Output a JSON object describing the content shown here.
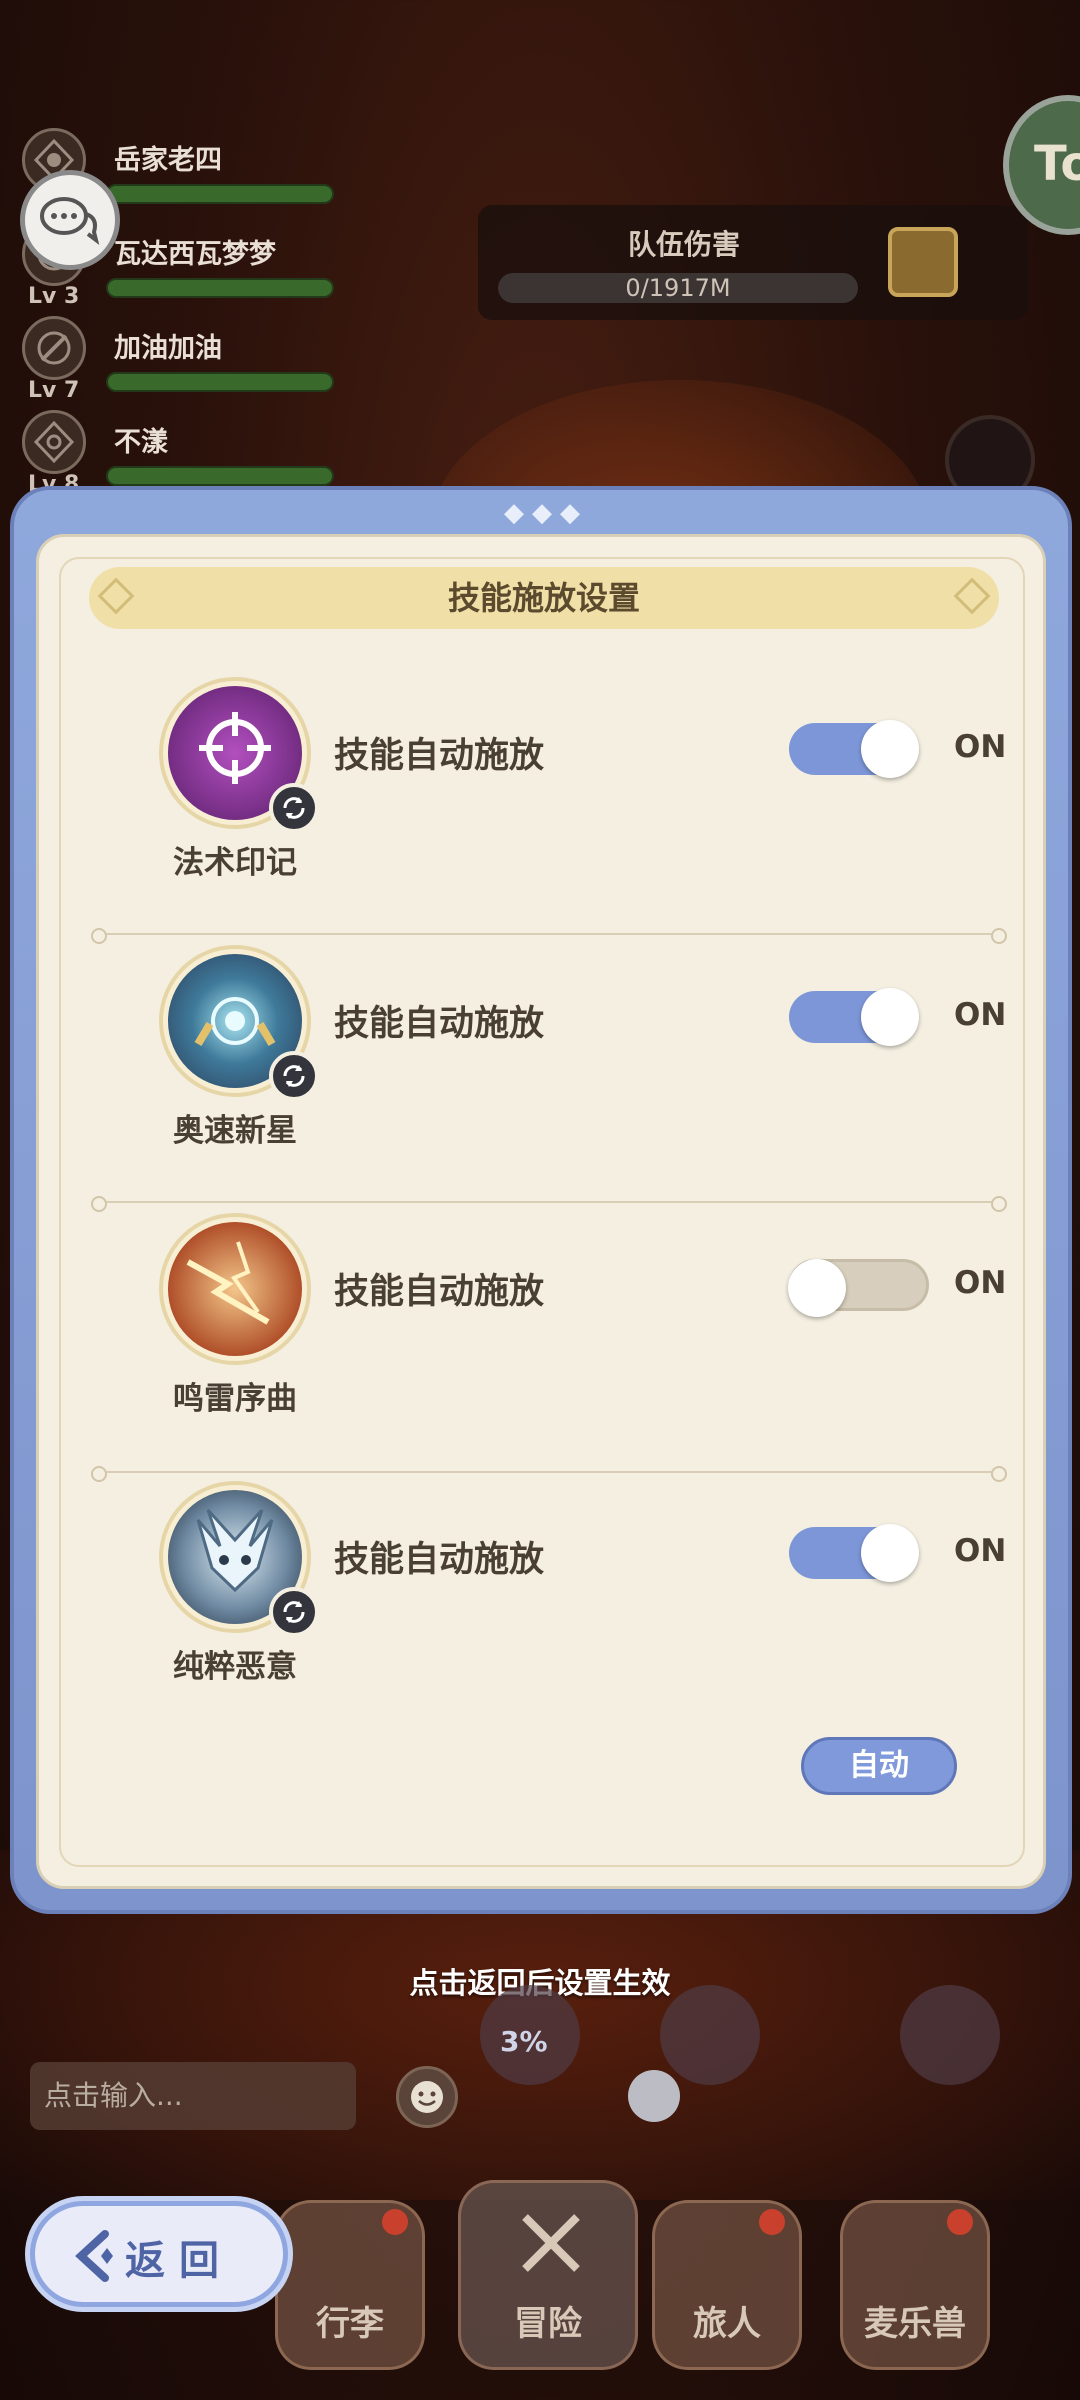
{
  "party": {
    "members": [
      {
        "name": "岳家老四",
        "level": ""
      },
      {
        "name": "瓦达西瓦梦梦",
        "level": "Lv 3"
      },
      {
        "name": "加油加油",
        "level": "Lv 7"
      },
      {
        "name": "不漾",
        "level": "Lv 8"
      }
    ]
  },
  "team_damage": {
    "label": "队伍伤害",
    "value": "0/1917M"
  },
  "corner_badge": "To",
  "dialog": {
    "title": "技能施放设置",
    "skills": [
      {
        "name": "法术印记",
        "auto_label": "技能自动施放",
        "state_label": "ON",
        "enabled": true
      },
      {
        "name": "奥速新星",
        "auto_label": "技能自动施放",
        "state_label": "ON",
        "enabled": true
      },
      {
        "name": "鸣雷序曲",
        "auto_label": "技能自动施放",
        "state_label": "ON",
        "enabled": false
      },
      {
        "name": "纯粹恶意",
        "auto_label": "技能自动施放",
        "state_label": "ON",
        "enabled": true
      }
    ],
    "auto_button": "自动"
  },
  "notice": "点击返回后设置生效",
  "percent": "3%",
  "chat": {
    "placeholder": "点击输入..."
  },
  "nav": {
    "back": "返回",
    "tabs": [
      "行李",
      "冒险",
      "旅人",
      "麦乐兽"
    ]
  },
  "colors": {
    "toggle_on": "#7c96d8",
    "toggle_off": "#d7cebd",
    "dialog_bg": "#f4efe1",
    "frame": "#8fa8dc"
  }
}
